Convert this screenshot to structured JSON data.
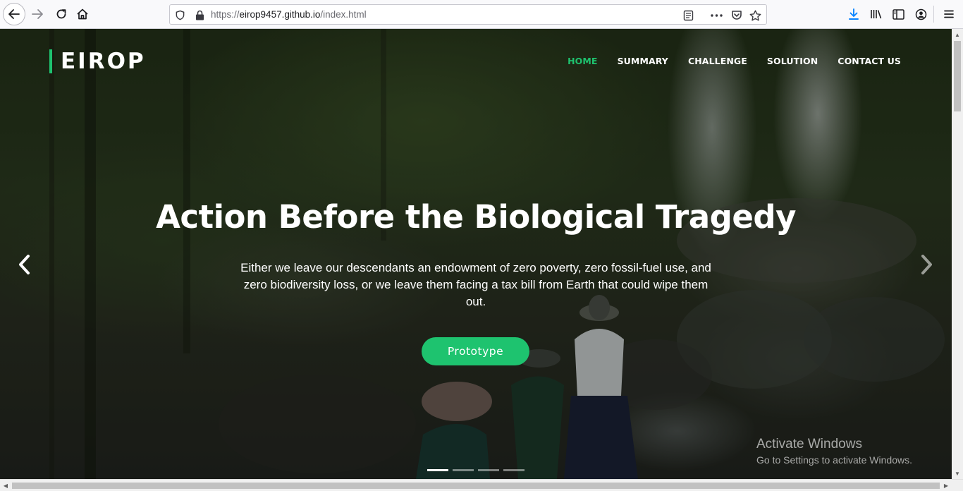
{
  "browser": {
    "url_prefix": "https://",
    "url_host": "eirop9457.github.io",
    "url_path": "/index.html",
    "icons": [
      "back-icon",
      "forward-icon",
      "reload-icon",
      "home-icon",
      "shield-icon",
      "lock-icon",
      "reader-view-icon",
      "more-icon",
      "pocket-icon",
      "bookmark-star-icon",
      "download-icon",
      "library-icon",
      "sidebar-icon",
      "account-icon",
      "menu-icon"
    ]
  },
  "site": {
    "logo": "EIROP",
    "nav": [
      {
        "label": "HOME",
        "active": true
      },
      {
        "label": "SUMMARY",
        "active": false
      },
      {
        "label": "CHALLENGE",
        "active": false
      },
      {
        "label": "SOLUTION",
        "active": false
      },
      {
        "label": "CONTACT US",
        "active": false
      }
    ],
    "accent_color": "#1ec36f"
  },
  "hero": {
    "title": "Action Before the Biological Tragedy",
    "text": "Either we leave our descendants an endowment of zero poverty, zero fossil-fuel use, and zero biodiversity loss, or we leave them facing a tax bill from Earth that could wipe them out.",
    "button_label": "Prototype",
    "slides": 4,
    "active_slide": 1
  },
  "watermark": {
    "title": "Activate Windows",
    "subtitle": "Go to Settings to activate Windows."
  }
}
